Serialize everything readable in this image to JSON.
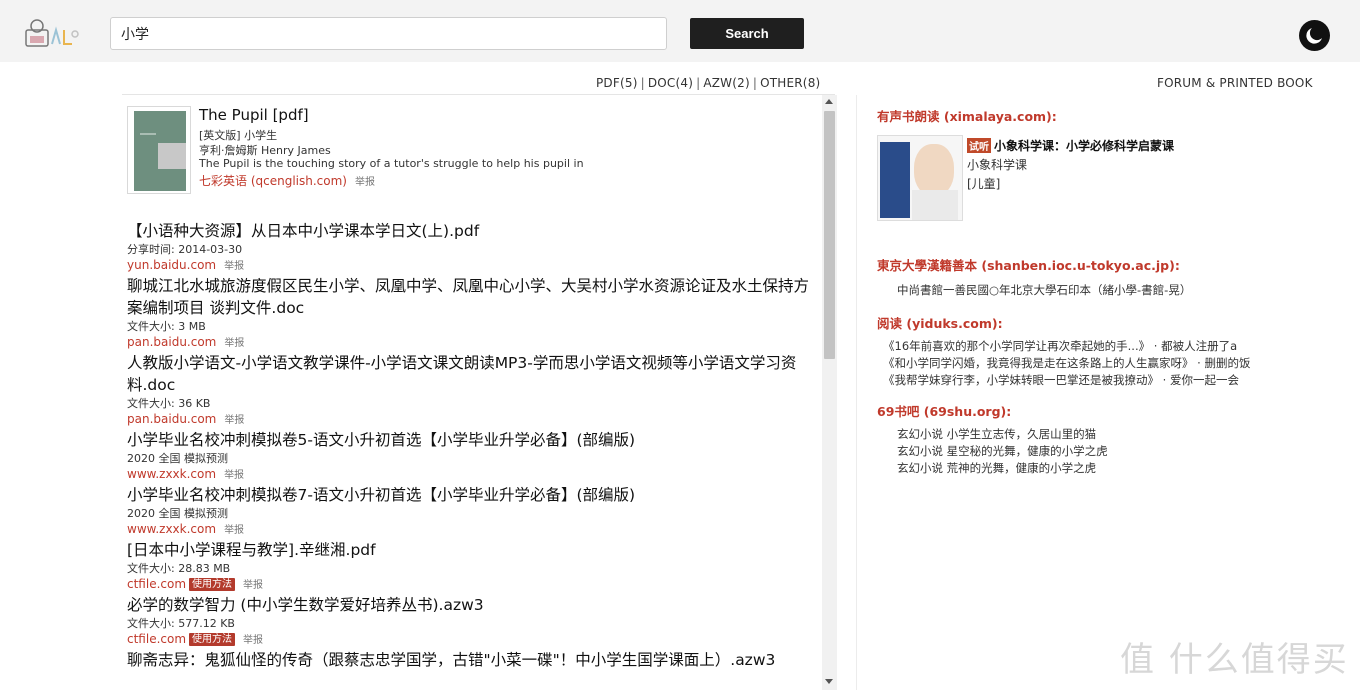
{
  "header": {
    "search_value": "小学",
    "search_button": "Search"
  },
  "filters": {
    "items": [
      "PDF(5)",
      "DOC(4)",
      "AZW(2)",
      "OTHER(8)"
    ],
    "separator": "|",
    "forum_link": "FORUM & PRINTED BOOK"
  },
  "featured": {
    "title": "The Pupil [pdf]",
    "line1": "[英文版] 小学生",
    "line2": "亨利·詹姆斯 Henry James",
    "line3": "The Pupil is the touching story of a tutor's struggle to help his pupil in",
    "source": "七彩英语 (qcenglish.com)",
    "report": "举报"
  },
  "results": [
    {
      "title": "【小语种大资源】从日本中小学课本学日文(上).pdf",
      "meta": "分享时间: 2014-03-30",
      "source": "yun.baidu.com",
      "badge": "",
      "report": "举报"
    },
    {
      "title": "聊城江北水城旅游度假区民生小学、凤凰中学、凤凰中心小学、大吴村小学水资源论证及水土保持方案编制项目 谈判文件.doc",
      "meta": "文件大小: 3 MB",
      "source": "pan.baidu.com",
      "badge": "",
      "report": "举报"
    },
    {
      "title": "人教版小学语文-小学语文教学课件-小学语文课文朗读MP3-学而思小学语文视频等小学语文学习资料.doc",
      "meta": "文件大小: 36 KB",
      "source": "pan.baidu.com",
      "badge": "",
      "report": "举报"
    },
    {
      "title": "小学毕业名校冲刺模拟卷5-语文小升初首选【小学毕业升学必备】(部编版)",
      "meta": "2020 全国 模拟预测",
      "source": "www.zxxk.com",
      "badge": "",
      "report": "举报"
    },
    {
      "title": "小学毕业名校冲刺模拟卷7-语文小升初首选【小学毕业升学必备】(部编版)",
      "meta": "2020 全国 模拟预测",
      "source": "www.zxxk.com",
      "badge": "",
      "report": "举报"
    },
    {
      "title": "[日本中小学课程与教学].辛继湘.pdf",
      "meta": "文件大小: 28.83 MB",
      "source": "ctfile.com",
      "badge": "使用方法",
      "report": "举报"
    },
    {
      "title": "必学的数学智力 (中小学生数学爱好培养丛书).azw3",
      "meta": "文件大小: 577.12 KB",
      "source": "ctfile.com",
      "badge": "使用方法",
      "report": "举报"
    },
    {
      "title": "聊斋志异：鬼狐仙怪的传奇（跟蔡志忠学国学，古错\"小菜一碟\"！中小学生国学课面上）.azw3",
      "meta": "",
      "source": "",
      "badge": "",
      "report": ""
    }
  ],
  "right": {
    "audio": {
      "header": "有声书朗读 (ximalaya.com):",
      "tag": "试听",
      "title": "小象科学课：小学必修科学启蒙课",
      "author": "小象科学课",
      "category": "[儿童]"
    },
    "tokyo": {
      "header": "東京大學漢籍善本 (shanben.ioc.u-tokyo.ac.jp):",
      "items": [
        "中尚書館一善民國○年北京大學石印本（緒小學-書館-晃）"
      ]
    },
    "yidu": {
      "header": "阅读 (yiduks.com):",
      "items": [
        "《16年前喜欢的那个小学同学让再次牵起她的手...》 · 都被人注册了a",
        "《和小学同学闪婚，我竟得我是走在这条路上的人生赢家呀》 · 删删的饭",
        "《我帮学妹穿行李，小学妹转眼一巴掌还是被我撩动》 · 爱你一起一会"
      ]
    },
    "shu69": {
      "header": "69书吧 (69shu.org):",
      "items": [
        "玄幻小说 小学生立志传，久居山里的猫",
        "玄幻小说 星空秘的光舞，健康的小学之虎",
        "玄幻小说 荒神的光舞，健康的小学之虎"
      ]
    }
  },
  "watermark": "值 什么值得买"
}
